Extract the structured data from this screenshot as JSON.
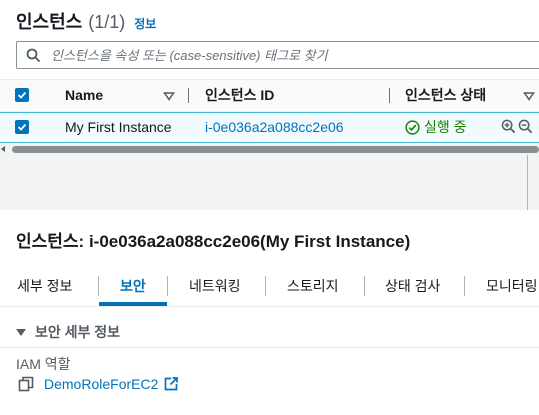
{
  "header": {
    "title": "인스턴스",
    "count": "(1/1)",
    "info_link": "정보"
  },
  "search": {
    "placeholder": "인스턴스을 속성 또는 (case-sensitive) 태그로 찾기",
    "icon": "search-icon"
  },
  "table": {
    "columns": [
      "Name",
      "인스턴스 ID",
      "인스턴스 상태"
    ],
    "rows": [
      {
        "name": "My First Instance",
        "instance_id": "i-0e036a2a088cc2e06",
        "state": "실행 중"
      }
    ]
  },
  "detail": {
    "title": "인스턴스: i-0e036a2a088cc2e06(My First Instance)",
    "tabs": [
      "세부 정보",
      "보안",
      "네트워킹",
      "스토리지",
      "상태 검사",
      "모니터링"
    ],
    "active_tab": "보안",
    "section_title": "보안 세부 정보",
    "iam_role_label": "IAM 역할",
    "iam_role_value": "DemoRoleForEC2"
  },
  "colors": {
    "accent": "#0073bb",
    "success": "#1d8102",
    "selected_row_bg": "#f1faff"
  }
}
